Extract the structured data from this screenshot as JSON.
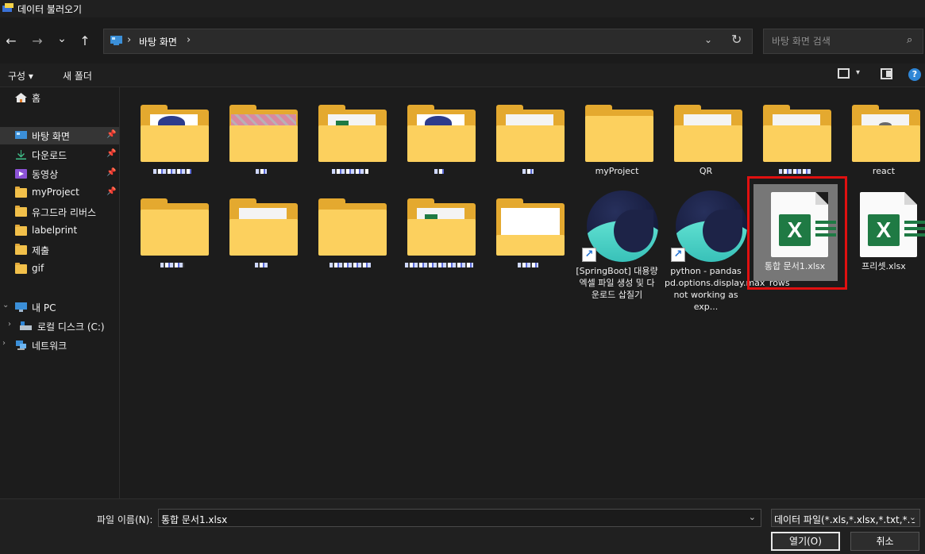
{
  "window": {
    "title": "데이터 불러오기"
  },
  "nav": {
    "back_glyph": "←",
    "forward_glyph": "→",
    "recent_glyph": "⌄",
    "up_glyph": "↑",
    "address_sep": "›",
    "address_path": "바탕 화면",
    "address_dropdown_glyph": "⌄",
    "refresh_glyph": "↻",
    "search_placeholder": "바탕 화면 검색",
    "search_glyph": "⌕"
  },
  "toolbar": {
    "organize_label": "구성 ▾",
    "new_folder_label": "새 폴더",
    "view_drop_glyph": "▾",
    "help_glyph": "?"
  },
  "sidebar": {
    "items": [
      {
        "label": "홈",
        "icon": "home-icon"
      },
      {
        "label": "바탕 화면",
        "icon": "desktop-icon",
        "pinned": true,
        "selected": true
      },
      {
        "label": "다운로드",
        "icon": "download-icon",
        "pinned": true
      },
      {
        "label": "동영상",
        "icon": "video-icon",
        "pinned": true
      },
      {
        "label": "myProject",
        "icon": "folder-icon",
        "pinned": true
      },
      {
        "label": "유그드라 리버스",
        "icon": "folder-icon"
      },
      {
        "label": "labelprint",
        "icon": "folder-icon"
      },
      {
        "label": "제출",
        "icon": "folder-icon"
      },
      {
        "label": "gif",
        "icon": "folder-icon"
      },
      {
        "label": "내 PC",
        "icon": "pc-icon"
      },
      {
        "label": "로컬 디스크 (C:)",
        "icon": "drive-icon"
      },
      {
        "label": "네트워크",
        "icon": "network-icon"
      }
    ],
    "pin_glyph": "📌",
    "expand_glyph": "›",
    "collapse_glyph": "⌄"
  },
  "files": {
    "row1": [
      {
        "label": "",
        "kind": "folder",
        "accent": "#2d3c8c"
      },
      {
        "label": "",
        "kind": "folder",
        "accent": "#d98aa0"
      },
      {
        "label": "",
        "kind": "folder",
        "accent": "#1f7a44"
      },
      {
        "label": "",
        "kind": "folder",
        "accent": "#2d3c8c"
      },
      {
        "label": "",
        "kind": "folder",
        "accent": "#f4f4f4"
      },
      {
        "label": "myProject",
        "kind": "folder",
        "accent": "#fcd05e"
      },
      {
        "label": "QR",
        "kind": "folder",
        "accent": "#f4f4f4"
      },
      {
        "label": "",
        "kind": "folder",
        "accent": "#f4f4f4"
      },
      {
        "label": "react",
        "kind": "folder",
        "accent": "#6a6a6a"
      }
    ],
    "row2": [
      {
        "label": "",
        "kind": "folder"
      },
      {
        "label": "",
        "kind": "folder"
      },
      {
        "label": "",
        "kind": "folder"
      },
      {
        "label": "",
        "kind": "folder"
      },
      {
        "label": "",
        "kind": "folder"
      },
      {
        "label": "[SpringBoot] 대용량 엑셀 파일 생성 및 다운로드 삽질기",
        "kind": "shortcut"
      },
      {
        "label": "python - pandas pd.options.display.max_rows not working as exp...",
        "kind": "shortcut"
      },
      {
        "label": "통합 문서1.xlsx",
        "kind": "xlsx",
        "selected": true
      },
      {
        "label": "프리셋.xlsx",
        "kind": "xlsx"
      }
    ],
    "xls_badge": "X",
    "shortcut_glyph": "↗"
  },
  "bottom": {
    "filename_label": "파일 이름(N):",
    "filename_value": "통합 문서1.xlsx",
    "filename_drop_glyph": "⌄",
    "filetype_value": "데이터 파일(*.xls,*.xlsx,*.txt,*.c",
    "filetype_drop_glyph": "⌄",
    "open_label": "열기(O)",
    "cancel_label": "취소"
  },
  "colors": {
    "accent_blue": "#2f86d6",
    "selection_frame": "#e01010",
    "excel_green": "#1f7a44",
    "folder_yellow": "#fcd05e"
  }
}
